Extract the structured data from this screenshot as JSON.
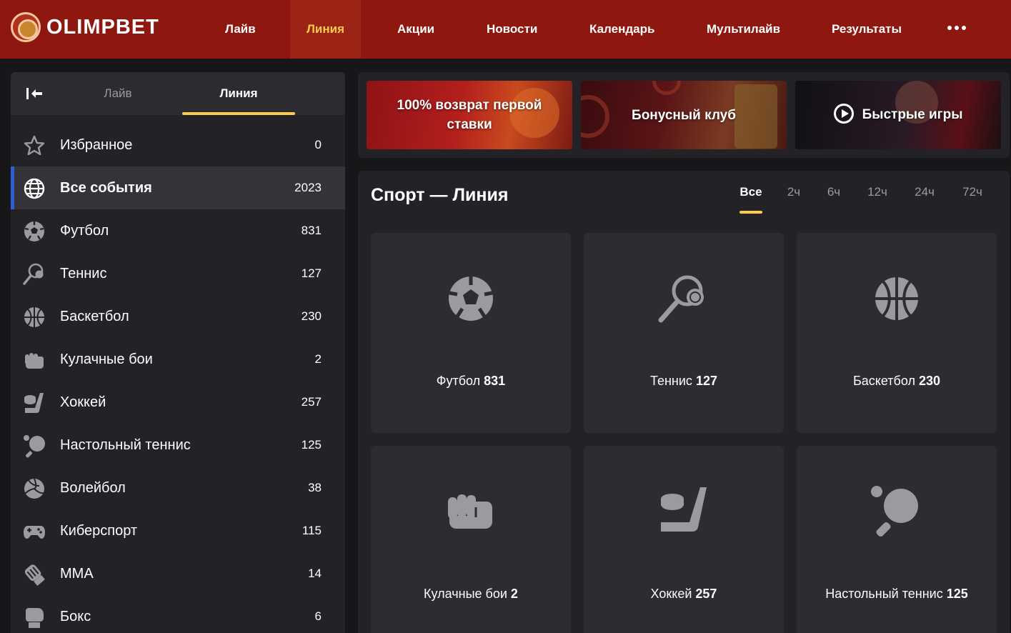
{
  "brand": {
    "name": "OLIMPBET",
    "accent": "#ffc94a",
    "header_bg": "#8e1710"
  },
  "nav": {
    "items": [
      {
        "label": "Лайв"
      },
      {
        "label": "Линия",
        "active": true
      },
      {
        "label": "Акции"
      },
      {
        "label": "Новости"
      },
      {
        "label": "Календарь"
      },
      {
        "label": "Мультилайв"
      },
      {
        "label": "Результаты"
      }
    ],
    "more_icon": "more-dots-icon"
  },
  "sidebar": {
    "tabs": [
      {
        "label": "Лайв"
      },
      {
        "label": "Линия",
        "active": true
      }
    ],
    "collapse_icon": "collapse-left-icon",
    "items": [
      {
        "icon": "star-icon",
        "label": "Избранное",
        "count": "0"
      },
      {
        "icon": "globe-icon",
        "label": "Все события",
        "count": "2023",
        "active": true
      },
      {
        "icon": "soccer-ball-icon",
        "label": "Футбол",
        "count": "831"
      },
      {
        "icon": "tennis-racket-icon",
        "label": "Теннис",
        "count": "127"
      },
      {
        "icon": "basketball-icon",
        "label": "Баскетбол",
        "count": "230"
      },
      {
        "icon": "fist-icon",
        "label": "Кулачные бои",
        "count": "2"
      },
      {
        "icon": "hockey-icon",
        "label": "Хоккей",
        "count": "257"
      },
      {
        "icon": "ping-pong-icon",
        "label": "Настольный теннис",
        "count": "125"
      },
      {
        "icon": "volleyball-icon",
        "label": "Волейбол",
        "count": "38"
      },
      {
        "icon": "gamepad-icon",
        "label": "Киберспорт",
        "count": "115"
      },
      {
        "icon": "mma-glove-icon",
        "label": "MMA",
        "count": "14"
      },
      {
        "icon": "boxing-glove-icon",
        "label": "Бокс",
        "count": "6"
      }
    ]
  },
  "promos": [
    {
      "label": "100% возврат первой ставки"
    },
    {
      "label": "Бонусный клуб"
    },
    {
      "label": "Быстрые игры",
      "icon": "play-circle-icon"
    }
  ],
  "main": {
    "title": "Спорт — Линия",
    "time_filters": [
      {
        "label": "Все",
        "active": true
      },
      {
        "label": "2ч"
      },
      {
        "label": "6ч"
      },
      {
        "label": "12ч"
      },
      {
        "label": "24ч"
      },
      {
        "label": "72ч"
      }
    ],
    "cards": [
      {
        "icon": "soccer-ball-icon",
        "name": "Футбол",
        "count": "831"
      },
      {
        "icon": "tennis-racket-icon",
        "name": "Теннис",
        "count": "127"
      },
      {
        "icon": "basketball-icon",
        "name": "Баскетбол",
        "count": "230"
      },
      {
        "icon": "fist-icon",
        "name": "Кулачные бои",
        "count": "2"
      },
      {
        "icon": "hockey-icon",
        "name": "Хоккей",
        "count": "257"
      },
      {
        "icon": "ping-pong-icon",
        "name": "Настольный теннис",
        "count": "125"
      }
    ]
  }
}
